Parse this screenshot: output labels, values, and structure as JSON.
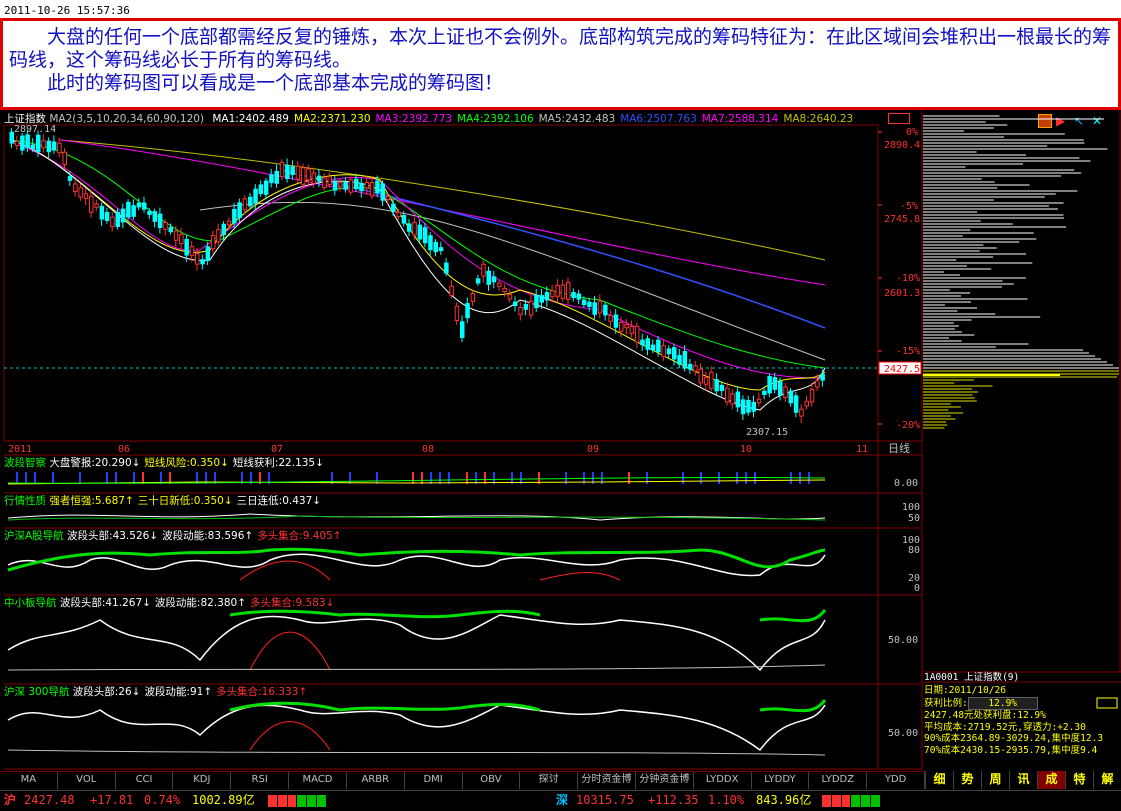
{
  "timestamp": "2011-10-26 15:57:36",
  "note": {
    "line1": "大盘的任何一个底部都需经反复的锤炼，本次上证也不会例外。底部构筑完成的筹码特征为：在此区域间会堆积出一根最长的筹码线，这个筹码线必长于所有的筹码线。",
    "line2": "此时的筹码图可以看成是一个底部基本完成的筹码图！"
  },
  "main_chart": {
    "name": "上证指数",
    "ma_params": "MA2(3,5,10,20,34,60,90,120)",
    "ma_values": [
      {
        "label": "MA1:2402.489",
        "color": "#ffffff"
      },
      {
        "label": "MA2:2371.230",
        "color": "#ffff00"
      },
      {
        "label": "MA3:2392.773",
        "color": "#ff00ff"
      },
      {
        "label": "MA4:2392.106",
        "color": "#00ff00"
      },
      {
        "label": "MA5:2432.483",
        "color": "#c0c0c0"
      },
      {
        "label": "MA6:2507.763",
        "color": "#3050ff"
      },
      {
        "label": "MA7:2588.314",
        "color": "#ff00ff"
      },
      {
        "label": "MA8:2640.23",
        "color": "#c0c000"
      }
    ],
    "high_label": "2897.14",
    "low_label": "2307.15",
    "current_price": "2427.5",
    "y_axis": [
      "0%",
      "2890.4",
      "-5%",
      "2745.8",
      "-10%",
      "2601.3",
      "-15%",
      "-20%"
    ],
    "x_axis": [
      "2011",
      "06",
      "07",
      "08",
      "09",
      "10",
      "11"
    ],
    "period": "日线"
  },
  "chart_data": {
    "type": "candlestick",
    "title": "上证指数",
    "ylim": [
      2250,
      2920
    ],
    "x": [
      "2011-05",
      "2011-06",
      "2011-07",
      "2011-08",
      "2011-09",
      "2011-10"
    ],
    "series": [
      {
        "name": "上证指数",
        "values": [
          2870,
          2720,
          2800,
          2610,
          2520,
          2427.48
        ]
      }
    ]
  },
  "indicators": [
    {
      "id": "ind1",
      "title": "波段智察",
      "parts": [
        {
          "t": "大盘警报:20.290↓",
          "c": "#ffffff"
        },
        {
          "t": "短线风险:0.350↓",
          "c": "#ffff00"
        },
        {
          "t": "短线获利:22.135↓",
          "c": "#ffffff"
        }
      ],
      "axis": [
        "0.00"
      ]
    },
    {
      "id": "ind2",
      "title": "行情性质",
      "parts": [
        {
          "t": "强者恒强:5.687↑",
          "c": "#ffff00"
        },
        {
          "t": "三十日新低:0.350↓",
          "c": "#ffff00"
        },
        {
          "t": "三日连低:0.437↓",
          "c": "#ffffff"
        }
      ],
      "axis": [
        "100",
        "50"
      ]
    },
    {
      "id": "ind3",
      "title": "沪深A股导航",
      "parts": [
        {
          "t": "波段头部:43.526↓",
          "c": "#ffffff"
        },
        {
          "t": "波段动能:83.596↑",
          "c": "#ffffff"
        },
        {
          "t": "多头集合:9.405↑",
          "c": "#ff3030"
        }
      ],
      "axis": [
        "100",
        "80",
        "20",
        "0"
      ]
    },
    {
      "id": "ind4",
      "title": "中小板导航",
      "parts": [
        {
          "t": "波段头部:41.267↓",
          "c": "#ffffff"
        },
        {
          "t": "波段动能:82.380↑",
          "c": "#ffffff"
        },
        {
          "t": "多头集合:9.583↓",
          "c": "#ff3030"
        }
      ],
      "axis": [
        "50.00"
      ]
    },
    {
      "id": "ind5",
      "title": "沪深 300导航",
      "parts": [
        {
          "t": "波段头部:26↓",
          "c": "#ffffff"
        },
        {
          "t": "波段动能:91↑",
          "c": "#ffffff"
        },
        {
          "t": "多头集合:16.333↑",
          "c": "#ff3030"
        }
      ],
      "axis": [
        "50.00"
      ]
    }
  ],
  "chip_panel": {
    "code": "1A0001",
    "name": "上证指数",
    "count": "(9)",
    "date_label": "日期:2011/10/26",
    "profit_label": "获利比例:",
    "profit_value": "12.9%",
    "line1": "2427.48元处获利盘:12.9%",
    "line2": "平均成本:2719.52元,穿透力:+2.30",
    "line3": "90%成本2364.89-3029.24,集中度12.3",
    "line4": "70%成本2430.15-2935.79,集中度9.4"
  },
  "bottom_tabs": [
    "MA",
    "VOL",
    "CCI",
    "KDJ",
    "RSI",
    "MACD",
    "ARBR",
    "DMI",
    "OBV",
    "探讨",
    "分时资金博",
    "分钟资金博",
    "LYDDX",
    "LYDDY",
    "LYDDZ",
    "YDD"
  ],
  "right_tabs": [
    "细",
    "势",
    "周",
    "讯",
    "成",
    "特",
    "解"
  ],
  "status": {
    "sh_label": "沪",
    "sh_price": "2427.48",
    "sh_change": "+17.81",
    "sh_pct": "0.74%",
    "sh_amount": "1002.89亿",
    "sz_label": "深",
    "sz_price": "10315.75",
    "sz_change": "+112.35",
    "sz_pct": "1.10%",
    "sz_amount": "843.96亿"
  },
  "colors": {
    "up": "#ff3030",
    "down": "#00ffff",
    "border": "#800000",
    "accent": "#ffff00"
  }
}
